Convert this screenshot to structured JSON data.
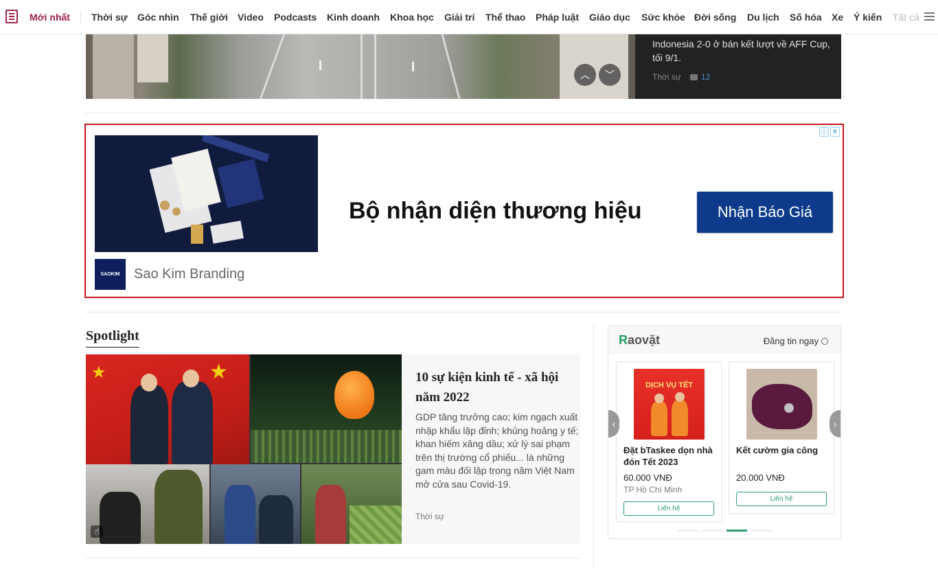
{
  "nav": {
    "latest": "Mới nhất",
    "items": [
      "Thời sự",
      "Góc nhìn",
      "Thế giới",
      "Video",
      "Podcasts",
      "Kinh doanh",
      "Khoa học",
      "Giải trí",
      "Thể thao",
      "Pháp luật",
      "Giáo dục",
      "Sức khỏe",
      "Đời sống",
      "Du lịch",
      "Số hóa",
      "Xe",
      "Ý kiến"
    ],
    "all": "Tất cả"
  },
  "hero_side": {
    "snippet": "Indonesia 2-0 ở bán kết lượt về AFF Cup, tối 9/1.",
    "category": "Thời sự",
    "comments": "12"
  },
  "ad": {
    "headline": "Bộ nhận diện thương hiệu",
    "cta": "Nhận Báo Giá",
    "brand": "Sao Kim Branding",
    "brand_logo_text": "SAOKIM",
    "info_icon": "ⓘ",
    "close_icon": "✕"
  },
  "spotlight": {
    "section_title": "Spotlight",
    "headline": "10 sự kiện kinh tế - xã hội năm 2022",
    "description": "GDP tăng trưởng cao; kim ngạch xuất nhập khẩu lập đỉnh; khủng hoảng y tế; khan hiếm xăng dầu; xử lý sai phạm trên thị trường cổ phiếu... là những gam màu đối lập trong năm Việt Nam mở cửa sau Covid-19.",
    "category": "Thời sự"
  },
  "raovat": {
    "logo_r": "R",
    "logo_rest": "aovặt",
    "post_label": "Đăng tin ngay",
    "items": [
      {
        "name": "Đặt bTaskee dọn nhà đón Tết 2023",
        "price": "60.000 VNĐ",
        "location": "TP Hồ Chí Minh",
        "button": "Liên hệ",
        "thumb_text": "DỊCH VỤ TẾT"
      },
      {
        "name": "Kết cườm gia công",
        "price": "20.000 VNĐ",
        "location": "",
        "button": "Liên hệ"
      }
    ]
  },
  "icons": {
    "up": "chevron-up-icon",
    "down": "chevron-down-icon",
    "menu": "hamburger-icon",
    "prev": "chevron-left-icon",
    "next": "chevron-right-icon"
  },
  "colors": {
    "brand": "#9f224e",
    "ad_border": "#c8161d",
    "cta": "#0d3a8a",
    "raovat_green": "#2a9d6c"
  }
}
